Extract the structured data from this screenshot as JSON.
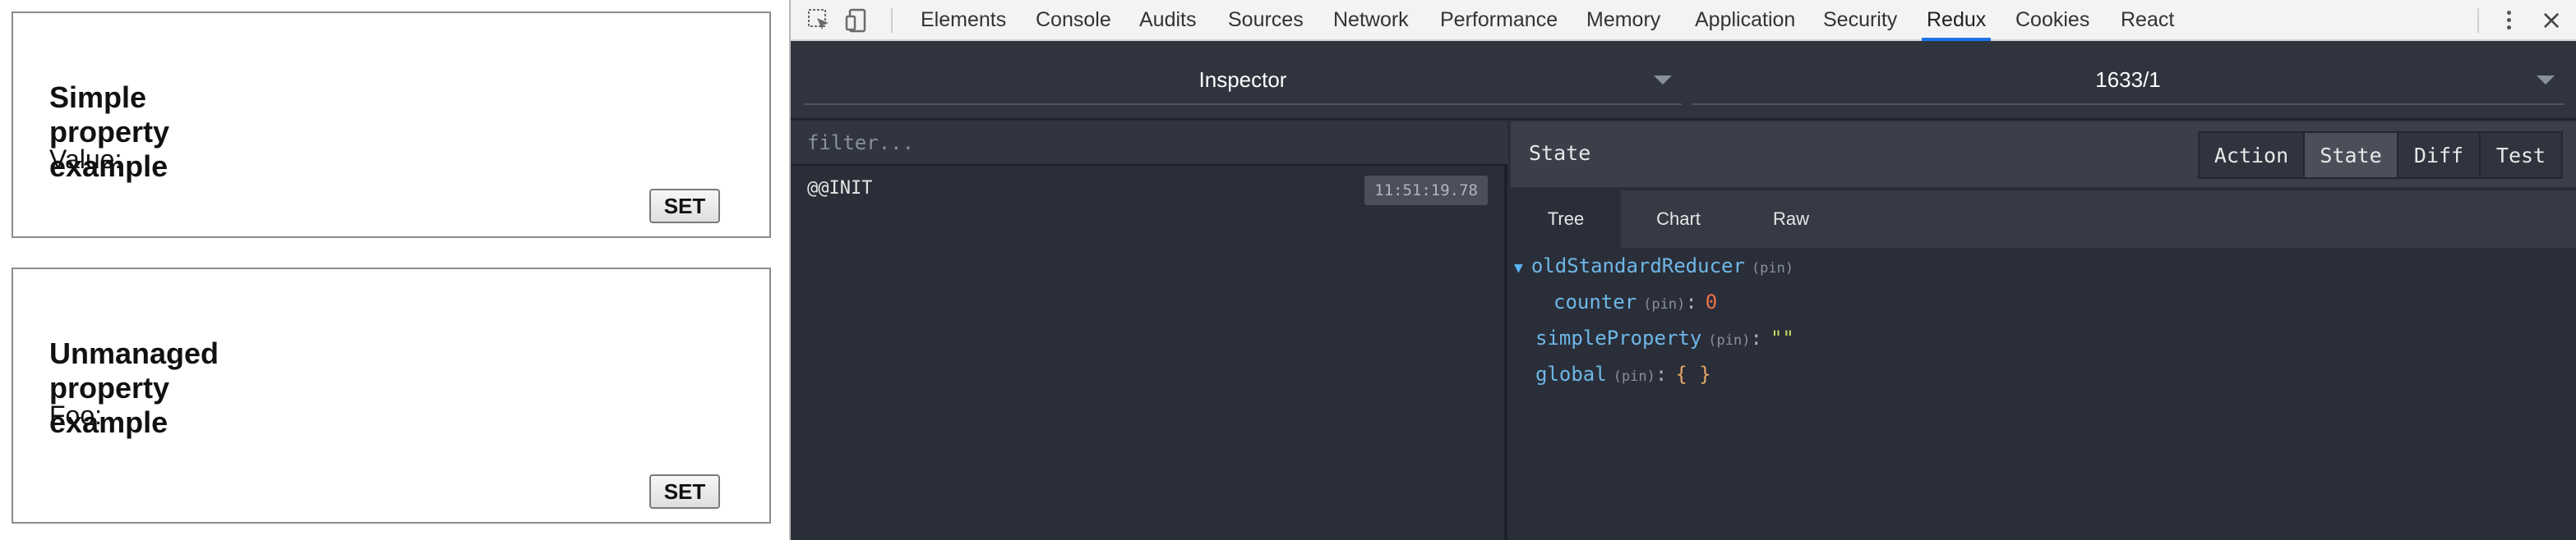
{
  "app": {
    "card1": {
      "title": "Simple property example",
      "label": "Value:",
      "button": "SET"
    },
    "card2": {
      "title": "Unmanaged property example",
      "label": "Foo:",
      "button": "SET"
    }
  },
  "devtools": {
    "toolbar_icons": [
      "inspect-element-icon",
      "device-toolbar-icon"
    ],
    "tabs": [
      "Elements",
      "Console",
      "Audits",
      "Sources",
      "Network",
      "Performance",
      "Memory",
      "Application",
      "Security",
      "Redux",
      "Cookies",
      "React"
    ],
    "active_tab": "Redux",
    "accent_color": "#1a73e8"
  },
  "redux": {
    "monitor_select": "Inspector",
    "instance_select": "1633/1",
    "filter_placeholder": "filter...",
    "actions": [
      {
        "type": "@@INIT",
        "time": "11:51:19.78"
      }
    ],
    "panel_title": "State",
    "mode_buttons": [
      "Action",
      "State",
      "Diff",
      "Test"
    ],
    "active_mode": "State",
    "sub_tabs": [
      "Tree",
      "Chart",
      "Raw"
    ],
    "active_sub_tab": "Tree",
    "tree": {
      "toggle_glyph": "▼",
      "pin_label": "(pin)",
      "colon": ":",
      "root_key": "oldStandardReducer",
      "child_key": "counter",
      "child_value": "0",
      "simple_key": "simpleProperty",
      "simple_value": "\"\"",
      "global_key": "global",
      "global_value": "{ }"
    }
  }
}
